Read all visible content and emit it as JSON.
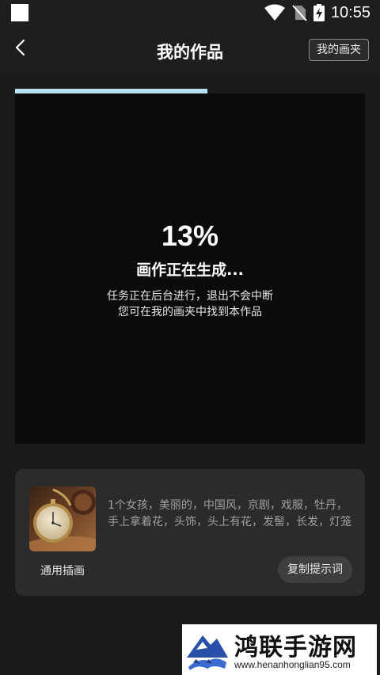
{
  "status_bar": {
    "time": "10:55",
    "icons": [
      "wifi-icon",
      "no-sim-icon",
      "battery-charging-icon"
    ]
  },
  "header": {
    "title": "我的作品",
    "folder_button": "我的画夹",
    "back_icon": "chevron-left-icon"
  },
  "generation": {
    "progress": 0.55,
    "percent_text": "13%",
    "status_title": "画作正在生成...",
    "desc_line1": "任务正在后台进行，退出不会中断",
    "desc_line2": "您可在我的画夹中找到本作品"
  },
  "prompt_card": {
    "style_label": "通用插画",
    "thumbnail": "pocket-watch-image",
    "prompt": "1个女孩，美丽的，中国风，京剧，戏服，牡丹，手上拿着花，头饰，头上有花，发髻，长发，灯笼",
    "copy_button": "复制提示词"
  },
  "watermark": {
    "name": "鸿联手游网",
    "url": "www.henanhonglian95.com"
  },
  "colors": {
    "background": "#1e1e1e",
    "canvas": "#0b0b0b",
    "progress": "#b8e2f2",
    "card": "#2b2b2b"
  }
}
